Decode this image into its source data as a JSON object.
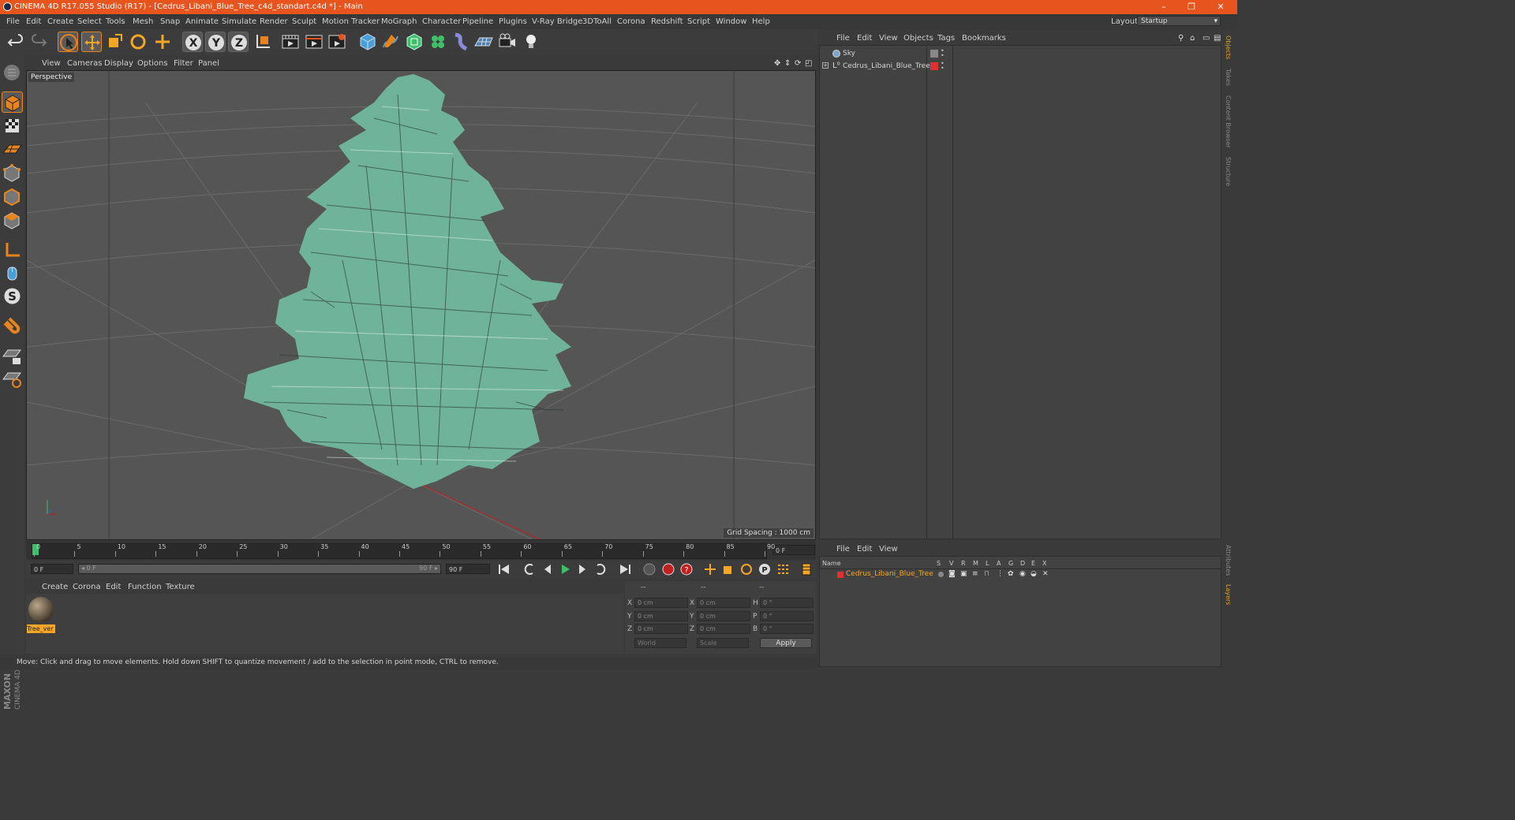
{
  "window": {
    "title": "CINEMA 4D R17.055 Studio (R17) - [Cedrus_Libani_Blue_Tree_c4d_standart.c4d *] - Main",
    "minimize": "–",
    "restore": "❐",
    "close": "✕"
  },
  "menu": [
    "File",
    "Edit",
    "Create",
    "Select",
    "Tools",
    "Mesh",
    "Snap",
    "Animate",
    "Simulate",
    "Render",
    "Sculpt",
    "Motion Tracker",
    "MoGraph",
    "Character",
    "Pipeline",
    "Plugins",
    "V-Ray Bridge",
    "3DToAll",
    "Corona",
    "Redshift",
    "Script",
    "Window",
    "Help"
  ],
  "layout": {
    "label": "Layout:",
    "value": "Startup"
  },
  "toolbar_icons": [
    "undo-icon",
    "redo-icon",
    "select-arrow-icon",
    "move-icon",
    "scale-icon",
    "rotate-icon",
    "add-icon",
    "x-axis-icon",
    "y-axis-icon",
    "z-axis-icon",
    "coordinate-system-icon",
    "render-view-icon",
    "render-picture-viewer-icon",
    "render-settings-icon",
    "cube-icon",
    "pen-spline-icon",
    "subdivision-icon",
    "cloner-icon",
    "deformer-icon",
    "floor-icon",
    "camera-icon",
    "light-icon"
  ],
  "viewport": {
    "menu": [
      "View",
      "Cameras",
      "Display",
      "Options",
      "Filter",
      "Panel"
    ],
    "label": "Perspective",
    "grid_spacing": "Grid Spacing : 1000 cm"
  },
  "timeline": {
    "ticks": [
      "0",
      "5",
      "10",
      "15",
      "20",
      "25",
      "30",
      "35",
      "40",
      "45",
      "50",
      "55",
      "60",
      "65",
      "70",
      "75",
      "80",
      "85",
      "90"
    ],
    "current_frame": "0 F",
    "start": "0 F",
    "range_start": "◂ 0 F",
    "range_end": "90 F ▸",
    "end": "90 F"
  },
  "materials": {
    "menu": [
      "Create",
      "Corona",
      "Edit",
      "Function",
      "Texture"
    ],
    "items": [
      {
        "name": "Tree_ver"
      }
    ]
  },
  "coordinates": {
    "headers": [
      "--",
      "--",
      "--"
    ],
    "rows": [
      {
        "pos_label": "X",
        "pos": "0 cm",
        "size_label": "X",
        "size": "0 cm",
        "rot_label": "H",
        "rot": "0 °"
      },
      {
        "pos_label": "Y",
        "pos": "0 cm",
        "size_label": "Y",
        "size": "0 cm",
        "rot_label": "P",
        "rot": "0 °"
      },
      {
        "pos_label": "Z",
        "pos": "0 cm",
        "size_label": "Z",
        "size": "0 cm",
        "rot_label": "B",
        "rot": "0 °"
      }
    ],
    "world": "World",
    "scale": "Scale",
    "apply": "Apply"
  },
  "status": "Move: Click and drag to move elements. Hold down SHIFT to quantize movement / add to the selection in point mode, CTRL to remove.",
  "objects": {
    "menu": [
      "File",
      "Edit",
      "View",
      "Objects",
      "Tags",
      "Bookmarks"
    ],
    "items": [
      {
        "name": "Sky"
      },
      {
        "name": "Cedrus_Libani_Blue_Tree"
      }
    ]
  },
  "layers": {
    "menu": [
      "File",
      "Edit",
      "View"
    ],
    "columns": [
      "Name",
      "S",
      "V",
      "R",
      "M",
      "L",
      "A",
      "G",
      "D",
      "E",
      "X"
    ],
    "items": [
      {
        "name": "Cedrus_Libani_Blue_Tree",
        "color": "#e03030"
      }
    ]
  },
  "side_tabs": [
    "Objects",
    "Takes",
    "Content Browser",
    "Structure"
  ],
  "side_tabs_lower": [
    "Attributes",
    "Layers"
  ],
  "brand": "MAXON CINEMA 4D",
  "colors": {
    "accent": "#e8541e",
    "tree": "#6fb39a",
    "layer": "#e03030",
    "highlight": "#f5a623"
  }
}
